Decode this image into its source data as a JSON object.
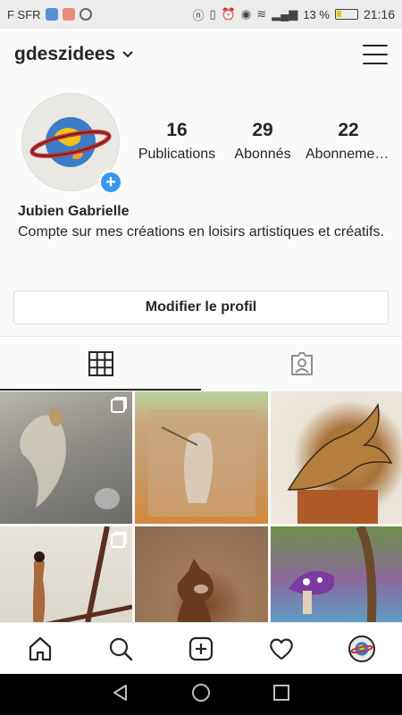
{
  "status_bar": {
    "carrier": "F SFR",
    "battery": "13 %",
    "time": "21:16"
  },
  "header": {
    "username": "gdeszidees"
  },
  "profile": {
    "stats": [
      {
        "value": "16",
        "label": "Publications"
      },
      {
        "value": "29",
        "label": "Abonnés"
      },
      {
        "value": "22",
        "label": "Abonnements"
      }
    ],
    "name": "Jubien Gabrielle",
    "bio": "Compte sur mes créations en loisirs artistiques et créatifs.",
    "edit_button": "Modifier le profil"
  },
  "tabs": [
    {
      "icon": "grid-icon",
      "active": true
    },
    {
      "icon": "tagged-icon",
      "active": false
    }
  ],
  "grid": {
    "posts": [
      {
        "subject": "winged-fairy-in-snow",
        "multi": true
      },
      {
        "subject": "angel-warrior-on-easel",
        "multi": false
      },
      {
        "subject": "golden-dragon",
        "multi": false
      },
      {
        "subject": "dancer-on-branches",
        "multi": true
      },
      {
        "subject": "horse-drawing",
        "multi": false
      },
      {
        "subject": "mushroom-fantasy-landscape",
        "multi": false
      }
    ]
  },
  "bottom_nav": [
    "home-icon",
    "search-icon",
    "new-post-icon",
    "activity-heart-icon",
    "profile-avatar"
  ],
  "colors": {
    "accent": "#3897f0",
    "text": "#262626",
    "border": "#dbdbdb",
    "background": "#fafafa"
  }
}
